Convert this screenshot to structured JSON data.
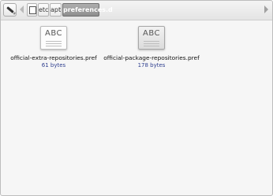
{
  "toolbar": {
    "edit_icon": "pencil-icon",
    "back_icon": "chevron-left-icon",
    "forward_icon": "chevron-right-icon",
    "root_icon": "drive-icon",
    "breadcrumbs": [
      "etc",
      "apt",
      "preferences.d"
    ]
  },
  "files": [
    {
      "icon_text": "ABC",
      "name": "official-extra-repositories.pref",
      "size": "61 bytes"
    },
    {
      "icon_text": "ABC",
      "name": "official-package-repositories.pref",
      "size": "178 bytes"
    }
  ]
}
